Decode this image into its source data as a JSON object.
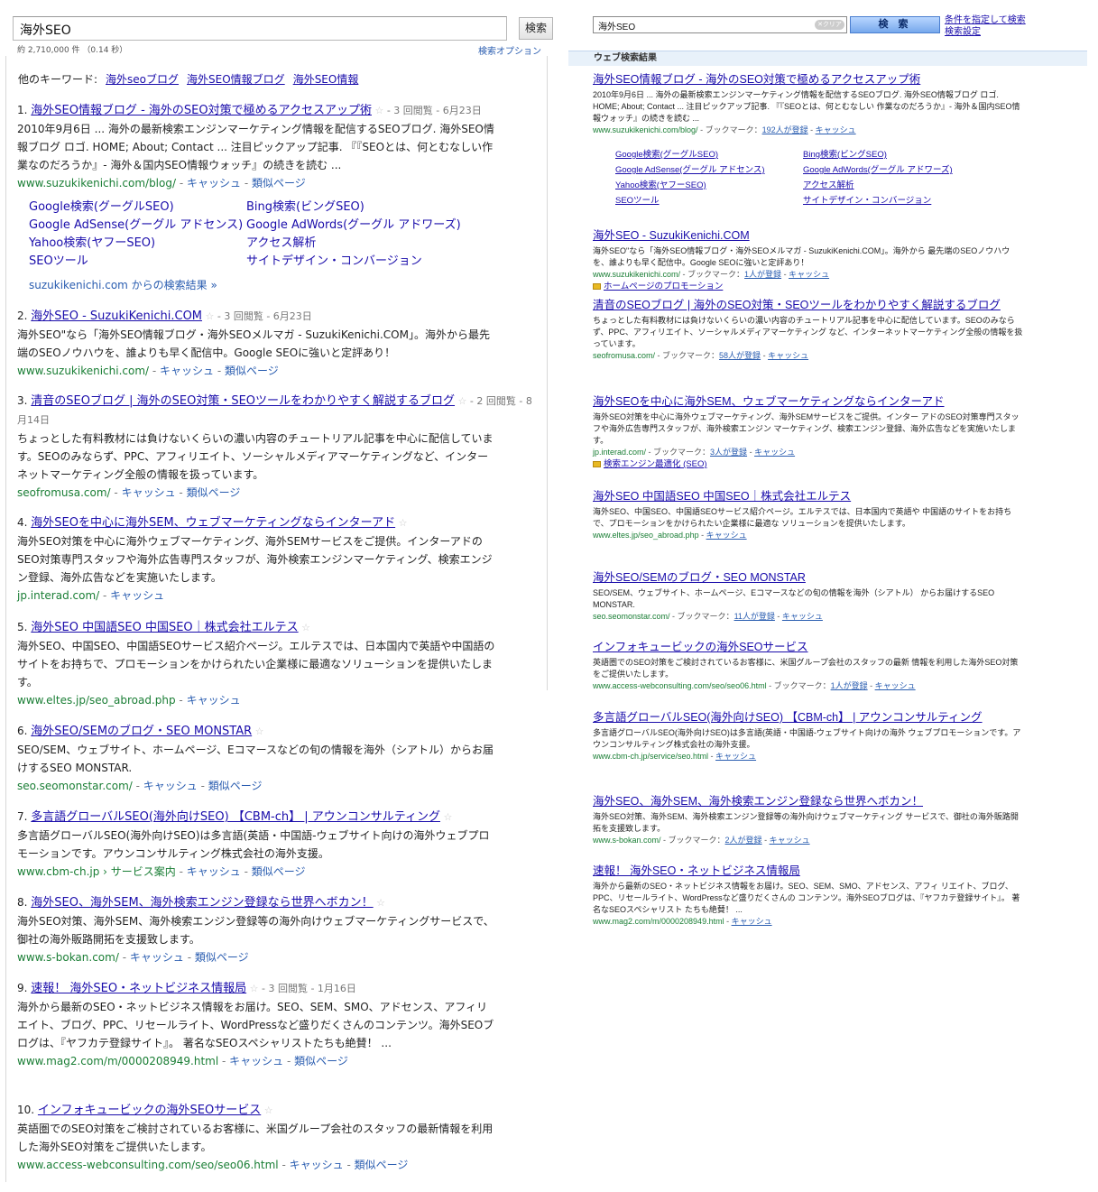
{
  "left": {
    "query": "海外SEO",
    "search_button": "検索",
    "stats": "約 2,710,000 件 （0.14 秒）",
    "options": "検索オプション",
    "related_label": "他のキーワード:",
    "related": [
      "海外seoブログ",
      "海外SEO情報ブログ",
      "海外SEO情報"
    ],
    "results": [
      {
        "num": "1.",
        "title": "海外SEO情報ブログ - 海外のSEO対策で極めるアクセスアップ術",
        "meta": "- 3 回閲覧 - 6月23日",
        "snippet": "2010年9月6日 ... 海外の最新検索エンジンマーケティング情報を配信するSEOブログ. 海外SEO情報ブログ ロゴ. HOME; About; Contact ... 注目ピックアップ記事. 『『SEOとは、何とむなしい作業なのだろうか』- 海外＆国内SEO情報ウォッチ』の続きを読む ...",
        "url": "www.suzukikenichi.com/blog/",
        "cache": "キャッシュ",
        "similar": "類似ページ"
      },
      {
        "num": "2.",
        "title": "海外SEO - SuzukiKenichi.COM",
        "meta": "- 3 回閲覧 - 6月23日",
        "snippet": "海外SEO\"なら「海外SEO情報ブログ・海外SEOメルマガ - SuzukiKenichi.COM」。海外から最先端のSEOノウハウを、誰よりも早く配信中。Google SEOに強いと定評あり！",
        "url": "www.suzukikenichi.com/",
        "cache": "キャッシュ",
        "similar": "類似ページ"
      },
      {
        "num": "3.",
        "title": "清音のSEOブログ | 海外のSEO対策・SEOツールをわかりやすく解説するブログ",
        "meta": "- 2 回閲覧 - 8月14日",
        "snippet": "ちょっとした有料教材には負けないくらいの濃い内容のチュートリアル記事を中心に配信しています。SEOのみならず、PPC、アフィリエイト、ソーシャルメディアマーケティングなど、インターネットマーケティング全般の情報を扱っています。",
        "url": "seofromusa.com/",
        "cache": "キャッシュ",
        "similar": "類似ページ"
      },
      {
        "num": "4.",
        "title": "海外SEOを中心に海外SEM、ウェブマーケティングならインターアド",
        "meta": "",
        "snippet": "海外SEO対策を中心に海外ウェブマーケティング、海外SEMサービスをご提供。インターアドのSEO対策専門スタッフや海外広告専門スタッフが、海外検索エンジンマーケティング、検索エンジン登録、海外広告などを実施いたします。",
        "url": "jp.interad.com/",
        "cache": "キャッシュ",
        "similar": ""
      },
      {
        "num": "5.",
        "title": "海外SEO 中国語SEO 中国SEO｜株式会社エルテス",
        "meta": "",
        "snippet": "海外SEO、中国SEO、中国語SEOサービス紹介ページ。エルテスでは、日本国内で英語や中国語のサイトをお持ちで、プロモーションをかけられたい企業様に最適なソリューションを提供いたします。",
        "url": "www.eltes.jp/seo_abroad.php",
        "cache": "キャッシュ",
        "similar": ""
      },
      {
        "num": "6.",
        "title": "海外SEO/SEMのブログ・SEO MONSTAR",
        "meta": "",
        "snippet": "SEO/SEM、ウェブサイト、ホームページ、Eコマースなどの旬の情報を海外（シアトル）からお届けするSEO MONSTAR.",
        "url": "seo.seomonstar.com/",
        "cache": "キャッシュ",
        "similar": "類似ページ"
      },
      {
        "num": "7.",
        "title": "多言語グローバルSEO(海外向けSEO) 【CBM-ch】 | アウンコンサルティング",
        "meta": "",
        "snippet": "多言語グローバルSEO(海外向けSEO)は多言語(英語・中国語-ウェブサイト向けの海外ウェブプロモーションです。アウンコンサルティング株式会社の海外支援。",
        "url": "www.cbm-ch.jp › サービス案内",
        "cache": "キャッシュ",
        "similar": "類似ページ"
      },
      {
        "num": "8.",
        "title": "海外SEO、海外SEM、海外検索エンジン登録なら世界へボカン！",
        "meta": "",
        "snippet": "海外SEO対策、海外SEM、海外検索エンジン登録等の海外向けウェブマーケティングサービスで、御社の海外販路開拓を支援致します。",
        "url": "www.s-bokan.com/",
        "cache": "キャッシュ",
        "similar": "類似ページ"
      },
      {
        "num": "9.",
        "title": "速報！ 海外SEO・ネットビジネス情報局",
        "meta": "- 3 回閲覧 - 1月16日",
        "snippet": "海外から最新のSEO・ネットビジネス情報をお届け。SEO、SEM、SMO、アドセンス、アフィリエイト、ブログ、PPC、リセールライト、WordPressなど盛りだくさんのコンテンツ。海外SEOブログは、『ヤフカテ登録サイト』。 著名なSEOスペシャリストたちも絶賛！ ...",
        "url": "www.mag2.com/m/0000208949.html",
        "cache": "キャッシュ",
        "similar": "類似ページ"
      },
      {
        "num": "10.",
        "title": "インフォキュービックの海外SEOサービス",
        "meta": "",
        "snippet": "英語圏でのSEO対策をご検討されているお客様に、米国グループ会社のスタッフの最新情報を利用した海外SEO対策をご提供いたします。",
        "url": "www.access-webconsulting.com/seo/seo06.html",
        "cache": "キャッシュ",
        "similar": "類似ページ"
      }
    ],
    "sitelinks": [
      "Google検索(グーグルSEO)",
      "Bing検索(ビングSEO)",
      "Google AdSense(グーグル アドセンス)",
      "Google AdWords(グーグル アドワーズ)",
      "Yahoo検索(ヤフーSEO)",
      "アクセス解析",
      "SEOツール",
      "サイトデザイン・コンバージョン"
    ],
    "sitelinks_more": "suzukikenichi.com からの検索結果 »"
  },
  "right": {
    "query": "海外SEO",
    "clear": "✕クリア",
    "search_button": "検 索",
    "link_advanced": "条件を指定して検索",
    "link_settings": "検索設定",
    "section_title": "ウェブ検索結果",
    "results": [
      {
        "title": "海外SEO情報ブログ - 海外のSEO対策で極めるアクセスアップ術",
        "snippet": "2010年9月6日 ... 海外の最新検索エンジンマーケティング情報を配信するSEOブログ. 海外SEO情報ブログ ロゴ. HOME; About; Contact ... 注目ピックアップ記事. 『『SEOとは、何とむなしい 作業なのだろうか』- 海外＆国内SEO情報ウォッチ』の続きを読む ...",
        "url": "www.suzukikenichi.com/blog/",
        "bookmark": "ブックマーク：",
        "bookmark_count": "192人が登録",
        "cache": "キャッシュ",
        "sub": ""
      },
      {
        "title": "海外SEO - SuzukiKenichi.COM",
        "snippet": "海外SEO\"なら「海外SEO情報ブログ・海外SEOメルマガ - SuzukiKenichi.COM」。海外から 最先端のSEOノウハウを、誰よりも早く配信中。Google SEOに強いと定評あり！",
        "url": "www.suzukikenichi.com/",
        "bookmark": "ブックマーク：",
        "bookmark_count": "1人が登録",
        "cache": "キャッシュ",
        "sub": "ホームページのプロモーション"
      },
      {
        "title": "清音のSEOブログ | 海外のSEO対策・SEOツールをわかりやすく解説するブログ",
        "snippet": "ちょっとした有料教材には負けないくらいの濃い内容のチュートリアル記事を中心に配信しています。SEOのみならず、PPC、アフィリエイト、ソーシャルメディアマーケティング など、インターネットマーケティング全般の情報を扱っています。",
        "url": "seofromusa.com/",
        "bookmark": "ブックマーク：",
        "bookmark_count": "58人が登録",
        "cache": "キャッシュ",
        "sub": ""
      },
      {
        "title": "海外SEOを中心に海外SEM、ウェブマーケティングならインターアド",
        "snippet": "海外SEO対策を中心に海外ウェブマーケティング、海外SEMサービスをご提供。インター アドのSEO対策専門スタッフや海外広告専門スタッフが、海外検索エンジン マーケティング、検索エンジン登録、海外広告などを実施いたします。",
        "url": "jp.interad.com/",
        "bookmark": "ブックマーク：",
        "bookmark_count": "3人が登録",
        "cache": "キャッシュ",
        "sub": "検索エンジン最適化 (SEO)"
      },
      {
        "title": "海外SEO 中国語SEO 中国SEO｜株式会社エルテス",
        "snippet": "海外SEO、中国SEO、中国語SEOサービス紹介ページ。エルテスでは、日本国内で英語や 中国語のサイトをお持ちで、プロモーションをかけられたい企業様に最適な ソリューションを提供いたします。",
        "url": "www.eltes.jp/seo_abroad.php",
        "bookmark": "",
        "bookmark_count": "",
        "cache": "キャッシュ",
        "sub": ""
      },
      {
        "title": "海外SEO/SEMのブログ・SEO MONSTAR",
        "snippet": "SEO/SEM、ウェブサイト、ホームページ、Eコマースなどの旬の情報を海外（シアトル） からお届けするSEO MONSTAR.",
        "url": "seo.seomonstar.com/",
        "bookmark": "ブックマーク：",
        "bookmark_count": "11人が登録",
        "cache": "キャッシュ",
        "sub": ""
      },
      {
        "title": "インフォキュービックの海外SEOサービス",
        "snippet": "英語圏でのSEO対策をご検討されているお客様に、米国グループ会社のスタッフの最新 情報を利用した海外SEO対策をご提供いたします。",
        "url": "www.access-webconsulting.com/seo/seo06.html",
        "bookmark": "ブックマーク：",
        "bookmark_count": "1人が登録",
        "cache": "キャッシュ",
        "sub": ""
      },
      {
        "title": "多言語グローバルSEO(海外向けSEO) 【CBM-ch】 | アウンコンサルティング",
        "snippet": "多言語グローバルSEO(海外向けSEO)は多言語(英語・中国語-ウェブサイト向けの海外 ウェブプロモーションです。アウンコンサルティング株式会社の海外支援。",
        "url": "www.cbm-ch.jp/service/seo.html",
        "bookmark": "",
        "bookmark_count": "",
        "cache": "キャッシュ",
        "sub": ""
      },
      {
        "title": "海外SEO、海外SEM、海外検索エンジン登録なら世界へボカン！",
        "snippet": "海外SEO対策、海外SEM、海外検索エンジン登録等の海外向けウェブマーケティング サービスで、御社の海外販路開拓を支援致します。",
        "url": "www.s-bokan.com/",
        "bookmark": "ブックマーク：",
        "bookmark_count": "2人が登録",
        "cache": "キャッシュ",
        "sub": ""
      },
      {
        "title": "速報！ 海外SEO・ネットビジネス情報局",
        "snippet": "海外から最新のSEO・ネットビジネス情報をお届け。SEO、SEM、SMO、アドセンス、アフィ リエイト、ブログ、PPC、リセールライト、WordPressなど盛りだくさんの コンテンツ。海外SEOブログは、『ヤフカテ登録サイト』。 著名なSEOスペシャリスト たちも絶賛！ ...",
        "url": "www.mag2.com/m/0000208949.html",
        "bookmark": "",
        "bookmark_count": "",
        "cache": "キャッシュ",
        "sub": ""
      }
    ],
    "sitelinks": [
      "Google検索(グーグルSEO)",
      "Bing検索(ビングSEO)",
      "Google AdSense(グーグル アドセンス)",
      "Google AdWords(グーグル アドワーズ)",
      "Yahoo検索(ヤフーSEO)",
      "アクセス解析",
      "SEOツール",
      "サイトデザイン・コンバージョン"
    ]
  },
  "colors": {
    "link": "#1a0dab",
    "url": "#1a7e35",
    "cache": "#2a5db0"
  }
}
